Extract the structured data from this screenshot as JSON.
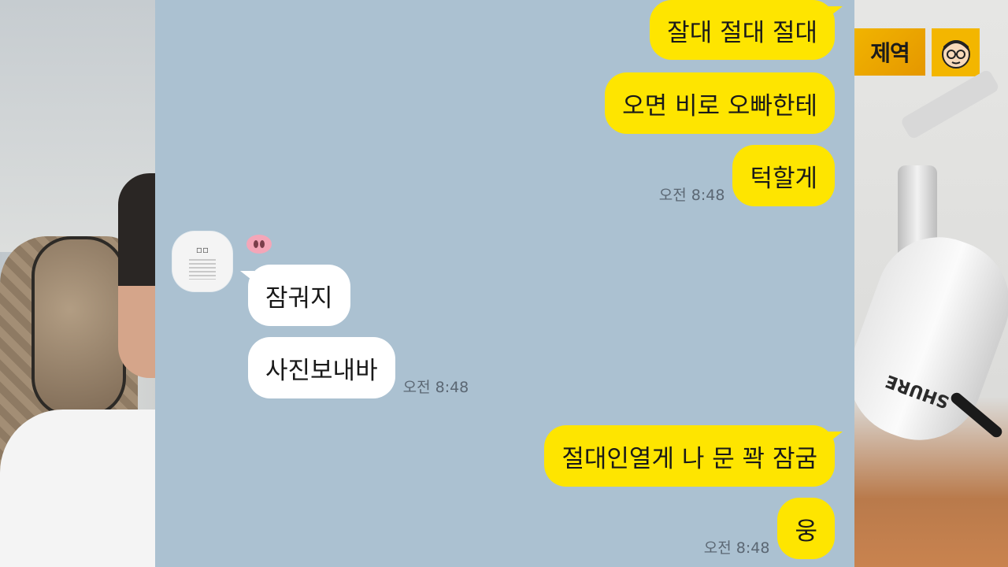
{
  "channel": {
    "logo_text": "제역"
  },
  "microphone": {
    "brand": "SHURE"
  },
  "chat": {
    "background_color": "#abc1d1",
    "my_bubble_color": "#fee500",
    "other_bubble_color": "#ffffff",
    "sender": {
      "name_icon": "pig-nose-emoji",
      "avatar_icon": "profile-image-icon"
    },
    "messages": [
      {
        "from": "me",
        "text": "잘대 절대 절대"
      },
      {
        "from": "me",
        "text": "오면 비로 오빠한테"
      },
      {
        "from": "me",
        "text": "턱할게",
        "time": "오전 8:48"
      },
      {
        "from": "other",
        "text": "잠궈지"
      },
      {
        "from": "other",
        "text": "사진보내바",
        "time": "오전 8:48"
      },
      {
        "from": "me",
        "text": "절대인열게 나 문 꽉 잠굼"
      },
      {
        "from": "me",
        "text": "웅",
        "time": "오전 8:48"
      }
    ]
  }
}
